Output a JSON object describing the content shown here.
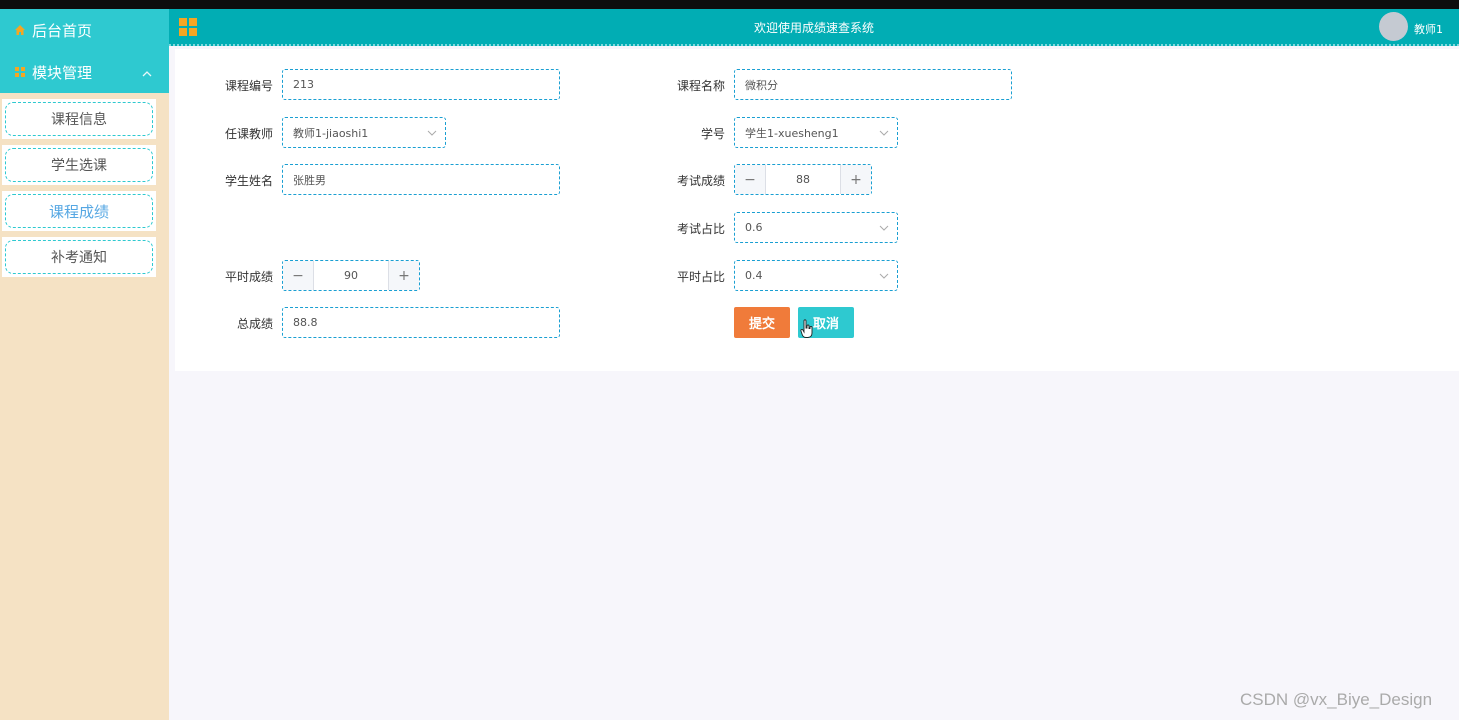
{
  "sidebar": {
    "home_label": "后台首页",
    "module_label": "模块管理",
    "items": [
      {
        "label": "课程信息"
      },
      {
        "label": "学生选课"
      },
      {
        "label": "课程成绩"
      },
      {
        "label": "补考通知"
      }
    ],
    "active_item": "课程成绩"
  },
  "header": {
    "title": "欢迎使用成绩速查系统",
    "username": "教师1"
  },
  "form": {
    "course_no_label": "课程编号",
    "course_no_value": "213",
    "course_name_label": "课程名称",
    "course_name_value": "微积分",
    "teacher_label": "任课教师",
    "teacher_value": "教师1-jiaoshi1",
    "student_no_label": "学号",
    "student_no_value": "学生1-xuesheng1",
    "student_name_label": "学生姓名",
    "student_name_value": "张胜男",
    "exam_score_label": "考试成绩",
    "exam_score_value": "88",
    "exam_ratio_label": "考试占比",
    "exam_ratio_value": "0.6",
    "usual_score_label": "平时成绩",
    "usual_score_value": "90",
    "usual_ratio_label": "平时占比",
    "usual_ratio_value": "0.4",
    "total_label": "总成绩",
    "total_value": "88.8",
    "submit_label": "提交",
    "cancel_label": "取消"
  },
  "watermark": "CSDN @vx_Biye_Design",
  "colors": {
    "header": "#01adb4",
    "menu_head": "#2ec9d0",
    "sidebar_bg": "#f5e2c4",
    "submit": "#f07b3a",
    "cancel": "#2ec9d0",
    "field_border": "#1a9fd2"
  },
  "icons": {
    "home": "home-icon",
    "module": "grid-icon",
    "apps": "apps-grid-icon",
    "chevron": "chevron-up-icon",
    "select_caret": "chevron-down-icon",
    "stepper_minus": "minus-icon",
    "stepper_plus": "plus-icon",
    "cursor": "hand-cursor-icon"
  }
}
